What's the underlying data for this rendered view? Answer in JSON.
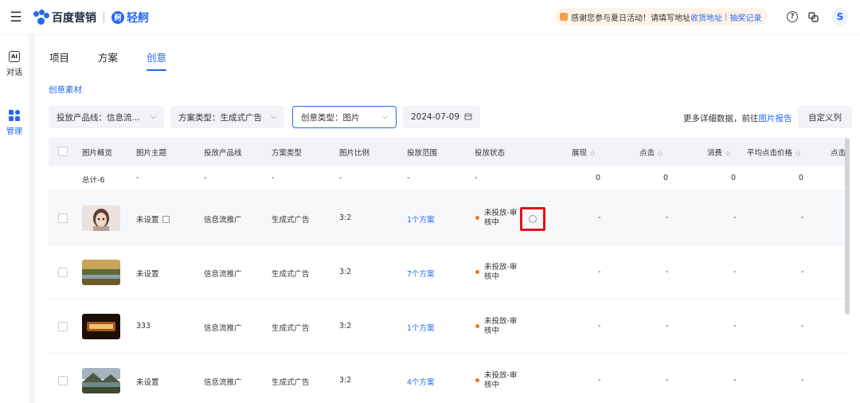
{
  "topbar": {
    "menu_icon": "hamburger-icon",
    "brand1": "百度营销",
    "brand2": "轻舸",
    "brand2_glyph": "舸",
    "notice": {
      "text": "感谢您参与夏日活动！请填写地址",
      "link1": "收货地址",
      "sep": "|",
      "link2": "抽奖记录"
    },
    "help_glyph": "?",
    "avatar_letter": "S"
  },
  "rail": {
    "items": [
      {
        "label": "对话",
        "icon": "chat-icon",
        "icon_glyph": "AI"
      },
      {
        "label": "管理",
        "icon": "grid-icon"
      }
    ]
  },
  "tabs": [
    "项目",
    "方案",
    "创意"
  ],
  "active_tab": "创意",
  "sub_title": "创意素材",
  "filters": {
    "product_line": "投放产品线：信息流...",
    "plan_type": "方案类型：生成式广告",
    "creative_type": "创意类型：图片",
    "date": "2024-07-09",
    "chevron": "⌵",
    "more_text": "更多详细数据，前往",
    "more_link": "图片报告",
    "custom_btn": "自定义列"
  },
  "table": {
    "headers": {
      "preview": "图片概览",
      "theme": "图片主题",
      "product": "投放产品线",
      "plan_type": "方案类型",
      "ratio": "图片比例",
      "scope": "投放范围",
      "status": "投放状态",
      "impressions": "展现",
      "clicks": "点击",
      "cost": "消费",
      "avg_cpc": "平均点击价格",
      "click_more": "点击",
      "sort_glyph": "◇"
    },
    "total": {
      "label": "总计-6",
      "dash": "-",
      "impressions": "0",
      "clicks": "0",
      "cost": "0",
      "avg_cpc": "0"
    },
    "rows": [
      {
        "theme": "未设置",
        "product": "信息流推广",
        "plan_type": "生成式广告",
        "ratio": "3:2",
        "scope": "1个方案",
        "status": "未投放-审核中",
        "impressions": "-",
        "clicks": "-",
        "cost": "-",
        "avg_cpc": "-",
        "thumb": "avatar-portrait"
      },
      {
        "theme": "未设置",
        "product": "信息流推广",
        "plan_type": "生成式广告",
        "ratio": "3:2",
        "scope": "7个方案",
        "status": "未投放-审核中",
        "impressions": "-",
        "clicks": "-",
        "cost": "-",
        "avg_cpc": "-",
        "thumb": "landscape"
      },
      {
        "theme": "333",
        "product": "信息流推广",
        "plan_type": "生成式广告",
        "ratio": "3:2",
        "scope": "1个方案",
        "status": "未投放-审核中",
        "impressions": "-",
        "clicks": "-",
        "cost": "-",
        "avg_cpc": "-",
        "thumb": "dark-sign"
      },
      {
        "theme": "未设置",
        "product": "信息流推广",
        "plan_type": "生成式广告",
        "ratio": "3:2",
        "scope": "4个方案",
        "status": "未投放-审核中",
        "impressions": "-",
        "clicks": "-",
        "cost": "-",
        "avg_cpc": "-",
        "thumb": "mountain-lake"
      }
    ]
  },
  "colors": {
    "accent": "#2468f2",
    "highlight": "#e1101a",
    "status_dot": "#f07a1a"
  }
}
